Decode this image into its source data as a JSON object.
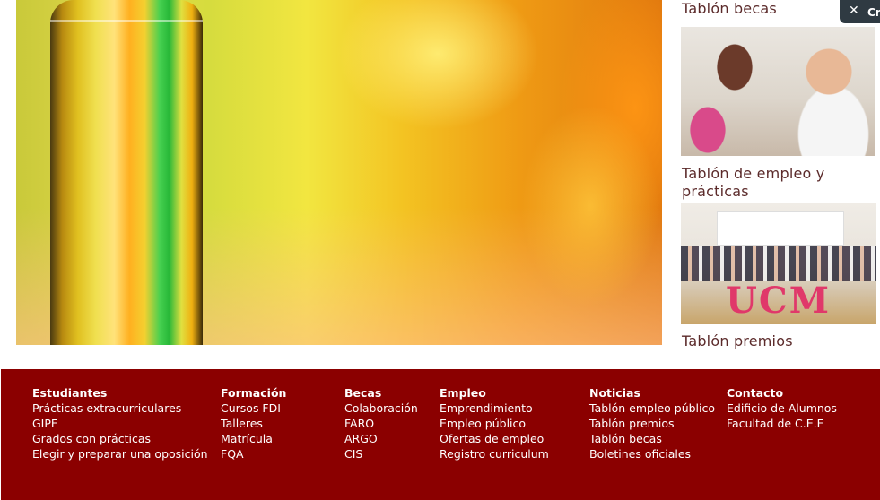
{
  "sidebar": {
    "labels": [
      "Tablón becas",
      "Tablón de empleo y prácticas",
      "Tablón premios"
    ],
    "ucm_text": "UCM"
  },
  "badge": {
    "text": "Cr"
  },
  "footer": {
    "columns": [
      {
        "title": "Estudiantes",
        "links": [
          "Prácticas extracurriculares",
          "GIPE",
          "Grados con prácticas",
          "Elegir y preparar una oposición"
        ]
      },
      {
        "title": "Formación",
        "links": [
          "Cursos FDI",
          "Talleres",
          "Matrícula",
          "FQA"
        ]
      },
      {
        "title": "Becas",
        "links": [
          "Colaboración",
          "FARO",
          "ARGO",
          "CIS"
        ]
      },
      {
        "title": "Empleo",
        "links": [
          "Emprendimiento",
          "Empleo público",
          "Ofertas de empleo",
          "Registro curriculum"
        ]
      },
      {
        "title": "Noticias",
        "links": [
          "Tablón empleo público",
          "Tablón premios",
          "Tablón becas",
          "Boletines oficiales"
        ]
      },
      {
        "title": "Contacto",
        "links": [
          "Edificio de Alumnos",
          "Facultad de C.E.E"
        ]
      }
    ]
  },
  "colors": {
    "footer_bg": "#8b0000",
    "label_text": "#5b2a2a",
    "badge_bg": "#2f3a42"
  }
}
